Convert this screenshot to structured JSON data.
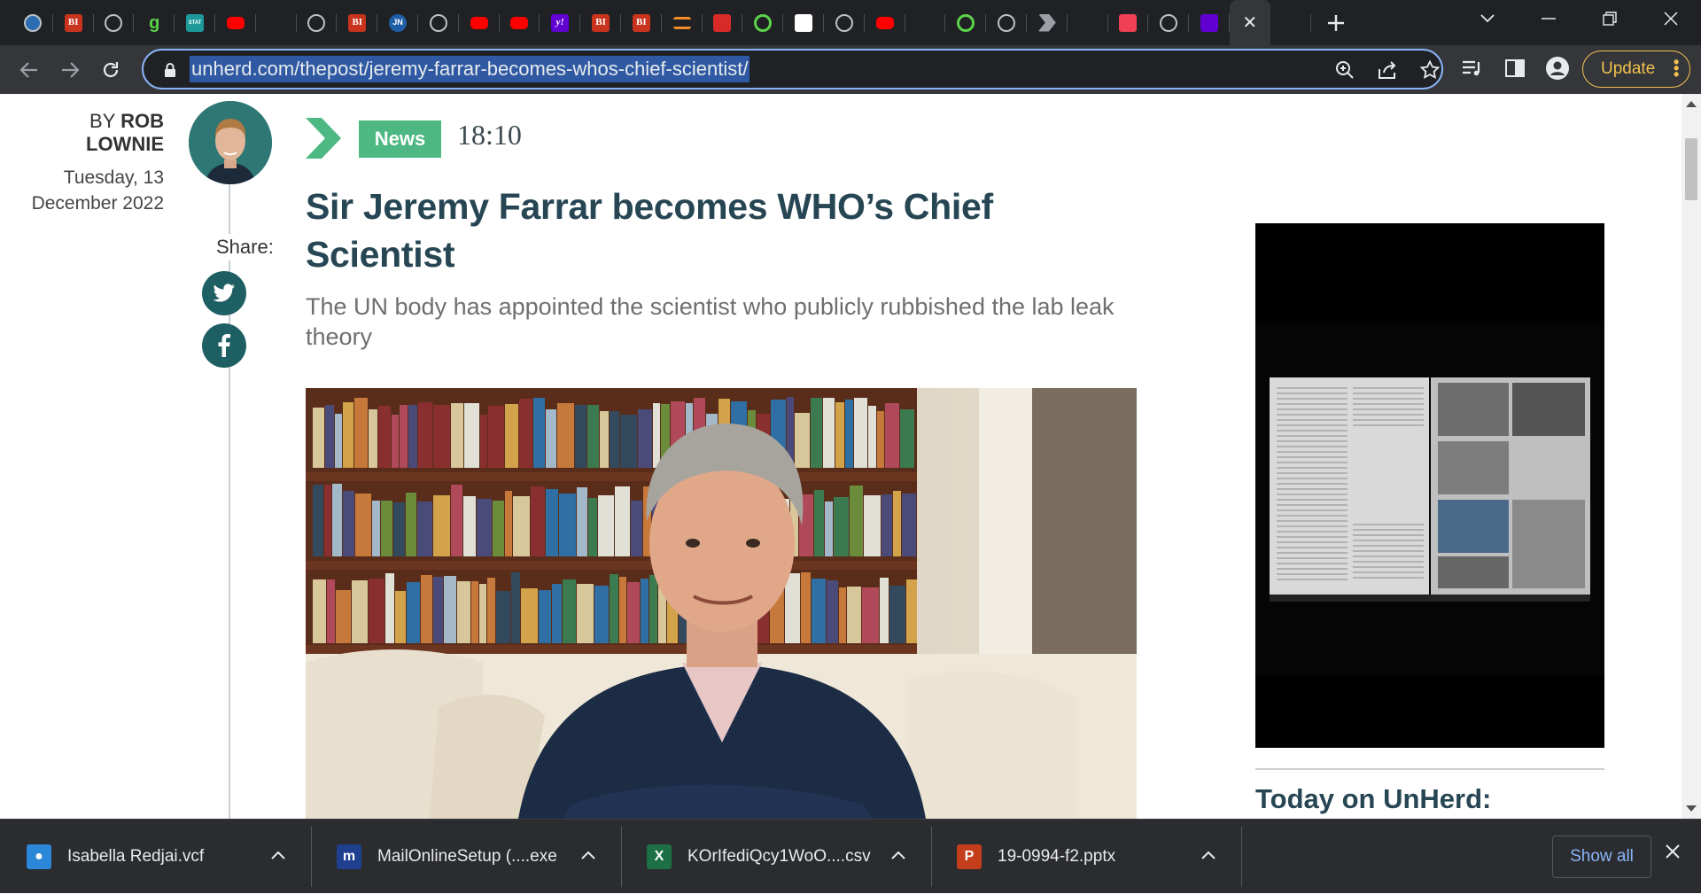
{
  "browser": {
    "tabs": [
      {
        "icon": "globe-colored-icon",
        "glyph": "",
        "bg": "#2a6db0"
      },
      {
        "icon": "business-insider-icon",
        "glyph": "BI",
        "bg": "#c8341e"
      },
      {
        "icon": "globe-icon",
        "glyph": "",
        "bg": ""
      },
      {
        "icon": "g-green-icon",
        "glyph": "g",
        "bg": ""
      },
      {
        "icon": "stat-icon",
        "glyph": "STAT",
        "bg": "#1c9a9a"
      },
      {
        "icon": "youtube-icon",
        "glyph": "",
        "bg": "#ff0000"
      },
      {
        "icon": "blank-icon",
        "glyph": "",
        "bg": ""
      },
      {
        "icon": "globe-icon",
        "glyph": "",
        "bg": ""
      },
      {
        "icon": "business-insider-icon",
        "glyph": "BI",
        "bg": "#c8341e"
      },
      {
        "icon": "jn-icon",
        "glyph": "JN",
        "bg": "#1f5fa8"
      },
      {
        "icon": "globe-network-icon",
        "glyph": "",
        "bg": ""
      },
      {
        "icon": "youtube-icon",
        "glyph": "",
        "bg": "#ff0000"
      },
      {
        "icon": "youtube-icon",
        "glyph": "",
        "bg": "#ff0000"
      },
      {
        "icon": "yahoo-icon",
        "glyph": "y!",
        "bg": "#6001d2"
      },
      {
        "icon": "business-insider-icon",
        "glyph": "BI",
        "bg": "#c8341e"
      },
      {
        "icon": "business-insider-icon",
        "glyph": "BI",
        "bg": "#c8341e"
      },
      {
        "icon": "bookmark-stack-icon",
        "glyph": "",
        "bg": ""
      },
      {
        "icon": "microphone-red-icon",
        "glyph": "",
        "bg": "#d92a2a"
      },
      {
        "icon": "play-green-icon",
        "glyph": "",
        "bg": ""
      },
      {
        "icon": "sheet-icon",
        "glyph": "",
        "bg": "#ffffff"
      },
      {
        "icon": "globe-icon",
        "glyph": "",
        "bg": ""
      },
      {
        "icon": "youtube-icon",
        "glyph": "",
        "bg": "#ff0000"
      },
      {
        "icon": "red-swirl-icon",
        "glyph": "",
        "bg": ""
      },
      {
        "icon": "play-green-icon",
        "glyph": "",
        "bg": ""
      },
      {
        "icon": "globe-icon",
        "glyph": "",
        "bg": ""
      },
      {
        "icon": "arrow-chevron-icon",
        "glyph": "",
        "bg": ""
      },
      {
        "icon": "search-blue-icon",
        "glyph": "",
        "bg": ""
      },
      {
        "icon": "pocket-icon",
        "glyph": "",
        "bg": "#ef4056"
      },
      {
        "icon": "globe-icon",
        "glyph": "",
        "bg": ""
      },
      {
        "icon": "yahoo-mail-icon",
        "glyph": "",
        "bg": "#6001d2"
      },
      {
        "icon": "close-icon",
        "glyph": "",
        "bg": "",
        "active": true
      },
      {
        "icon": "search-blue-icon",
        "glyph": "",
        "bg": ""
      }
    ],
    "url": "unherd.com/thepost/jeremy-farrar-becomes-whos-chief-scientist/",
    "update_label": "Update"
  },
  "article": {
    "byline_prefix": "BY",
    "author": "ROB LOWNIE",
    "date": "Tuesday, 13 December 2022",
    "share_label": "Share:",
    "tag": "News",
    "time": "18:10",
    "headline": "Sir Jeremy Farrar becomes WHO’s Chief Scientist",
    "standfirst": "The UN body has appointed the scientist who publicly rubbished the lab leak theory"
  },
  "sidebar": {
    "today_heading": "Today on UnHerd:"
  },
  "downloads": {
    "items": [
      {
        "name": "Isabella Redjai.vcf",
        "icon": "contact-card-icon"
      },
      {
        "name": "MailOnlineSetup (....exe",
        "icon": "mailonline-icon"
      },
      {
        "name": "KOrIfediQcy1WoO....csv",
        "icon": "excel-icon"
      },
      {
        "name": "19-0994-f2.pptx",
        "icon": "powerpoint-icon"
      }
    ],
    "show_all_label": "Show all"
  },
  "colors": {
    "accent_green": "#4db882",
    "headline": "#274654",
    "share_circle": "#1e5f63",
    "update": "#f2c14e"
  }
}
